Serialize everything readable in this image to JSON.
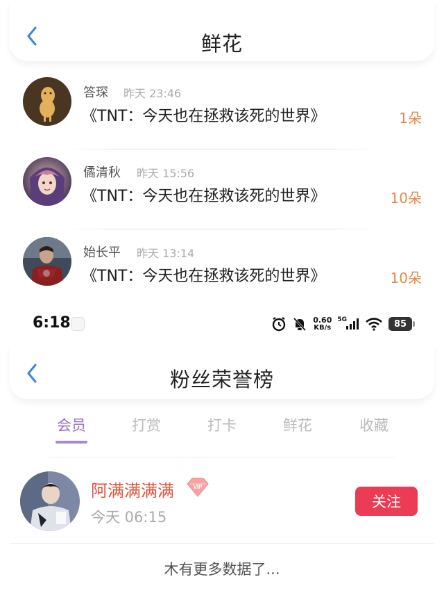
{
  "flowers_screen": {
    "title": "鲜花",
    "items": [
      {
        "name": "答琛",
        "time": "昨天 23:46",
        "book": "《TNT：今天也在拯救该死的世界》",
        "count": "1朵",
        "avatar": "peanut-avatar"
      },
      {
        "name": "僪清秋",
        "time": "昨天 15:56",
        "book": "《TNT：今天也在拯救该死的世界》",
        "count": "10朵",
        "avatar": "anime-girl-avatar"
      },
      {
        "name": "始长平",
        "time": "昨天 13:14",
        "book": "《TNT：今天也在拯救该死的世界》",
        "count": "10朵",
        "avatar": "ironman-avatar"
      }
    ]
  },
  "statusbar": {
    "time": "6:18",
    "net_speed": "0.60",
    "net_unit": "KB/s",
    "network": "5G",
    "battery": "85"
  },
  "fans_screen": {
    "title": "粉丝荣誉榜",
    "tabs": [
      "会员",
      "打赏",
      "打卡",
      "鲜花",
      "收藏"
    ],
    "active_tab": "会员",
    "member": {
      "name": "阿满满满满",
      "badge": "VIP",
      "time": "今天 06:15",
      "follow_label": "关注"
    },
    "empty_text": "木有更多数据了..."
  },
  "colors": {
    "accent_blue": "#3a86d8",
    "count_orange": "#e38a4a",
    "member_name": "#e0553c",
    "follow_button": "#eb3b55",
    "tab_active": "#9a6fc9"
  }
}
